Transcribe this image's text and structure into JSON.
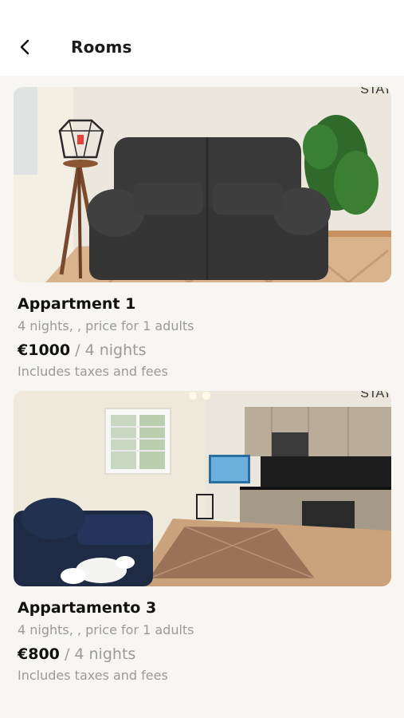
{
  "header": {
    "title": "Rooms",
    "back_icon": "chevron-left-icon"
  },
  "rooms": [
    {
      "name": "Appartment 1",
      "summary": "4 nights, , price for 1 adults",
      "price": "€1000",
      "separator": "/",
      "price_period": "4 nights",
      "fees_note": "Includes taxes and fees",
      "photo_watermark": "STAY"
    },
    {
      "name": "Appartamento 3",
      "summary": "4 nights, , price for 1 adults",
      "price": "€800",
      "separator": "/",
      "price_period": "4 nights",
      "fees_note": "Includes taxes and fees",
      "photo_watermark": "STAY"
    }
  ],
  "colors": {
    "background": "#f8f6f2",
    "header": "#ffffff",
    "muted_text": "#9a9a9a",
    "text": "#111111"
  }
}
